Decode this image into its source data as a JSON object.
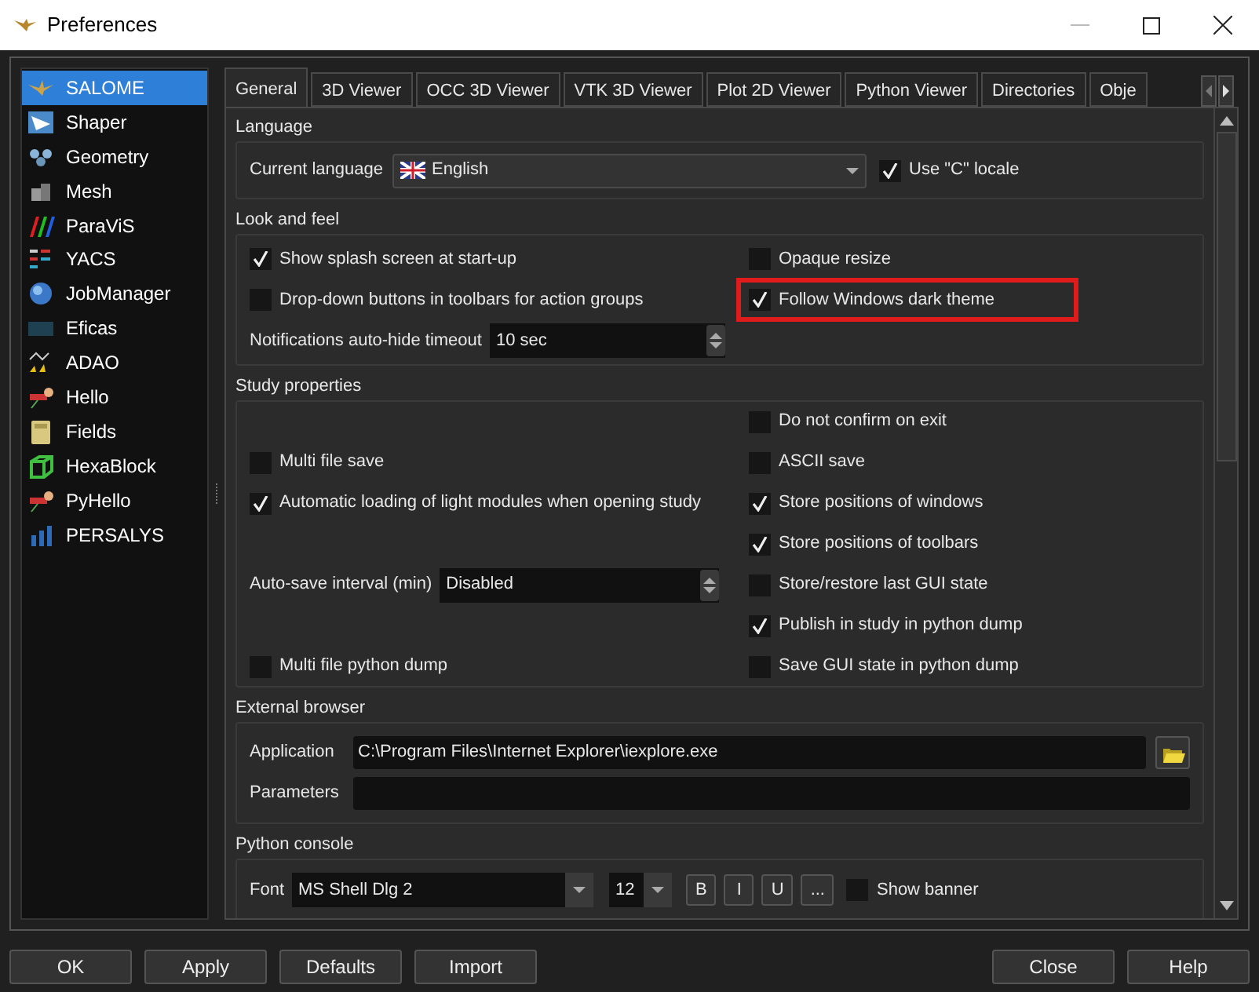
{
  "window": {
    "title": "Preferences"
  },
  "sidebar": {
    "items": [
      {
        "label": "SALOME",
        "selected": true
      },
      {
        "label": "Shaper",
        "selected": false
      },
      {
        "label": "Geometry",
        "selected": false
      },
      {
        "label": "Mesh",
        "selected": false
      },
      {
        "label": "ParaViS",
        "selected": false
      },
      {
        "label": "YACS",
        "selected": false
      },
      {
        "label": "JobManager",
        "selected": false
      },
      {
        "label": "Eficas",
        "selected": false
      },
      {
        "label": "ADAO",
        "selected": false
      },
      {
        "label": "Hello",
        "selected": false
      },
      {
        "label": "Fields",
        "selected": false
      },
      {
        "label": "HexaBlock",
        "selected": false
      },
      {
        "label": "PyHello",
        "selected": false
      },
      {
        "label": "PERSALYS",
        "selected": false
      }
    ]
  },
  "tabs": [
    {
      "label": "General",
      "selected": true
    },
    {
      "label": "3D Viewer",
      "selected": false
    },
    {
      "label": "OCC 3D Viewer",
      "selected": false
    },
    {
      "label": "VTK 3D Viewer",
      "selected": false
    },
    {
      "label": "Plot 2D Viewer",
      "selected": false
    },
    {
      "label": "Python Viewer",
      "selected": false
    },
    {
      "label": "Directories",
      "selected": false
    },
    {
      "label": "Obje",
      "selected": false
    }
  ],
  "sections": [
    {
      "title": "Language",
      "rows": [
        {
          "items": [
            {
              "kind": "combo",
              "label": "Current language",
              "value": "English"
            },
            {
              "kind": "checkbox",
              "label": "Use \"C\" locale",
              "checked": true
            }
          ]
        }
      ]
    },
    {
      "title": "Look and feel",
      "rows": [
        {
          "left": {
            "kind": "checkbox",
            "label": "Show splash screen at start-up",
            "checked": true
          },
          "right": {
            "kind": "checkbox",
            "label": "Opaque resize",
            "checked": false
          }
        },
        {
          "left": {
            "kind": "checkbox",
            "label": "Drop-down buttons in toolbars for action groups",
            "checked": false
          },
          "right": {
            "kind": "checkbox",
            "label": "Follow Windows dark theme",
            "checked": true,
            "highlighted": true
          }
        },
        {
          "left": {
            "kind": "spin",
            "label": "Notifications auto-hide timeout",
            "value": "10 sec"
          }
        }
      ]
    },
    {
      "title": "Study properties",
      "rows": [
        {
          "right": {
            "kind": "checkbox",
            "label": "Do not confirm on exit",
            "checked": false
          }
        },
        {
          "left": {
            "kind": "checkbox",
            "label": "Multi file save",
            "checked": false
          },
          "right": {
            "kind": "checkbox",
            "label": "ASCII save",
            "checked": false
          }
        },
        {
          "left": {
            "kind": "checkbox",
            "label": "Automatic loading of light modules when opening study",
            "checked": true
          },
          "right": {
            "kind": "checkbox",
            "label": "Store positions of windows",
            "checked": true
          }
        },
        {
          "right": {
            "kind": "checkbox",
            "label": "Store positions of toolbars",
            "checked": true
          }
        },
        {
          "left": {
            "kind": "spin",
            "label": "Auto-save interval (min)",
            "value": "Disabled"
          },
          "right": {
            "kind": "checkbox",
            "label": "Store/restore last GUI state",
            "checked": false
          }
        },
        {
          "right": {
            "kind": "checkbox",
            "label": "Publish in study in python dump",
            "checked": true
          }
        },
        {
          "left": {
            "kind": "checkbox",
            "label": "Multi file python dump",
            "checked": false
          },
          "right": {
            "kind": "checkbox",
            "label": "Save GUI state in python dump",
            "checked": false
          }
        }
      ]
    },
    {
      "title": "External browser",
      "rows": [
        {
          "items": [
            {
              "kind": "path",
              "label": "Application",
              "value": "C:\\Program Files\\Internet Explorer\\iexplore.exe"
            }
          ]
        },
        {
          "items": [
            {
              "kind": "path",
              "label": "Parameters"
            }
          ]
        }
      ]
    },
    {
      "title": "Python console",
      "rows": [
        {
          "items": [
            {
              "kind": "font",
              "label": "Font",
              "family": "MS Shell Dlg 2",
              "size": "12",
              "buttons": [
                "B",
                "I",
                "U",
                "..."
              ]
            },
            {
              "kind": "checkbox",
              "label": "Show banner",
              "checked": false
            }
          ]
        }
      ]
    }
  ],
  "buttons": {
    "left": [
      "OK",
      "Apply",
      "Defaults",
      "Import"
    ],
    "right": [
      "Close",
      "Help"
    ]
  }
}
